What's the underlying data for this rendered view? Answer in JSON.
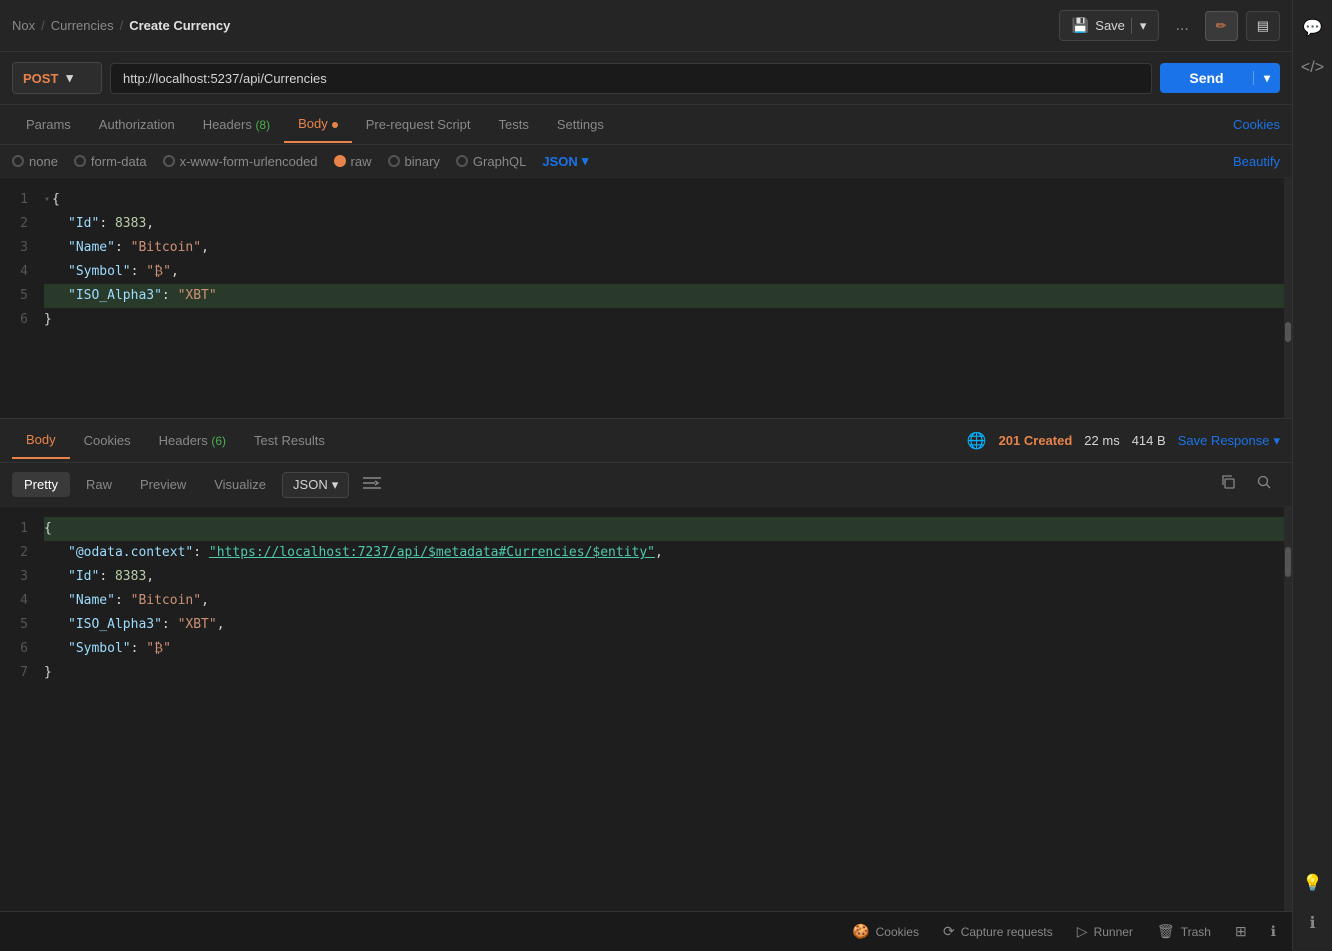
{
  "breadcrumb": {
    "part1": "Nox",
    "sep1": "/",
    "part2": "Currencies",
    "sep2": "/",
    "current": "Create Currency"
  },
  "toolbar": {
    "save_label": "Save",
    "dots": "...",
    "edit_icon": "✏",
    "doc_icon": "📄",
    "doc2_icon": "📋"
  },
  "request": {
    "method": "POST",
    "url": "http://localhost:5237/api/Currencies",
    "send_label": "Send"
  },
  "tabs": {
    "params": "Params",
    "authorization": "Authorization",
    "headers": "Headers",
    "headers_count": "(8)",
    "body": "Body",
    "pre_request": "Pre-request Script",
    "tests": "Tests",
    "settings": "Settings",
    "cookies_link": "Cookies"
  },
  "body_types": {
    "none": "none",
    "form_data": "form-data",
    "urlencoded": "x-www-form-urlencoded",
    "raw": "raw",
    "binary": "binary",
    "graphql": "GraphQL",
    "json_format": "JSON",
    "beautify": "Beautify"
  },
  "request_body": {
    "lines": [
      {
        "num": 1,
        "content": "{",
        "type": "brace"
      },
      {
        "num": 2,
        "key": "\"Id\"",
        "value": "8383",
        "value_type": "num",
        "trailing": ","
      },
      {
        "num": 3,
        "key": "\"Name\"",
        "value": "\"Bitcoin\"",
        "value_type": "str",
        "trailing": ","
      },
      {
        "num": 4,
        "key": "\"Symbol\"",
        "value": "\"₿\"",
        "value_type": "str",
        "trailing": ","
      },
      {
        "num": 5,
        "key": "\"ISO_Alpha3\"",
        "value": "\"XBT\"",
        "value_type": "str",
        "highlighted": true
      },
      {
        "num": 6,
        "content": "}",
        "type": "brace"
      }
    ]
  },
  "response": {
    "tabs": {
      "body": "Body",
      "cookies": "Cookies",
      "headers": "Headers",
      "headers_count": "(6)",
      "test_results": "Test Results"
    },
    "status": "201 Created",
    "time": "22 ms",
    "size": "414 B",
    "save_response": "Save Response",
    "format_tabs": {
      "pretty": "Pretty",
      "raw": "Raw",
      "preview": "Preview",
      "visualize": "Visualize",
      "json": "JSON"
    },
    "lines": [
      {
        "num": 1,
        "content": "{",
        "highlighted": true
      },
      {
        "num": 2,
        "key": "\"@odata.context\"",
        "value": "\"https://localhost:7237/api/$metadata#Currencies/$entity\"",
        "value_type": "link",
        "trailing": ","
      },
      {
        "num": 3,
        "key": "\"Id\"",
        "value": "8383",
        "value_type": "num",
        "trailing": ","
      },
      {
        "num": 4,
        "key": "\"Name\"",
        "value": "\"Bitcoin\"",
        "value_type": "str",
        "trailing": ","
      },
      {
        "num": 5,
        "key": "\"ISO_Alpha3\"",
        "value": "\"XBT\"",
        "value_type": "str",
        "trailing": ","
      },
      {
        "num": 6,
        "key": "\"Symbol\"",
        "value": "\"₿\"",
        "value_type": "str"
      },
      {
        "num": 7,
        "content": "}",
        "type": "brace"
      }
    ]
  },
  "bottom_bar": {
    "cookies": "Cookies",
    "capture": "Capture requests",
    "runner": "Runner",
    "trash": "Trash",
    "add_icon": "⊞",
    "info_icon": "ℹ"
  },
  "sidebar": {
    "icons": [
      "💬",
      "</>",
      "💡",
      "ℹ"
    ]
  }
}
